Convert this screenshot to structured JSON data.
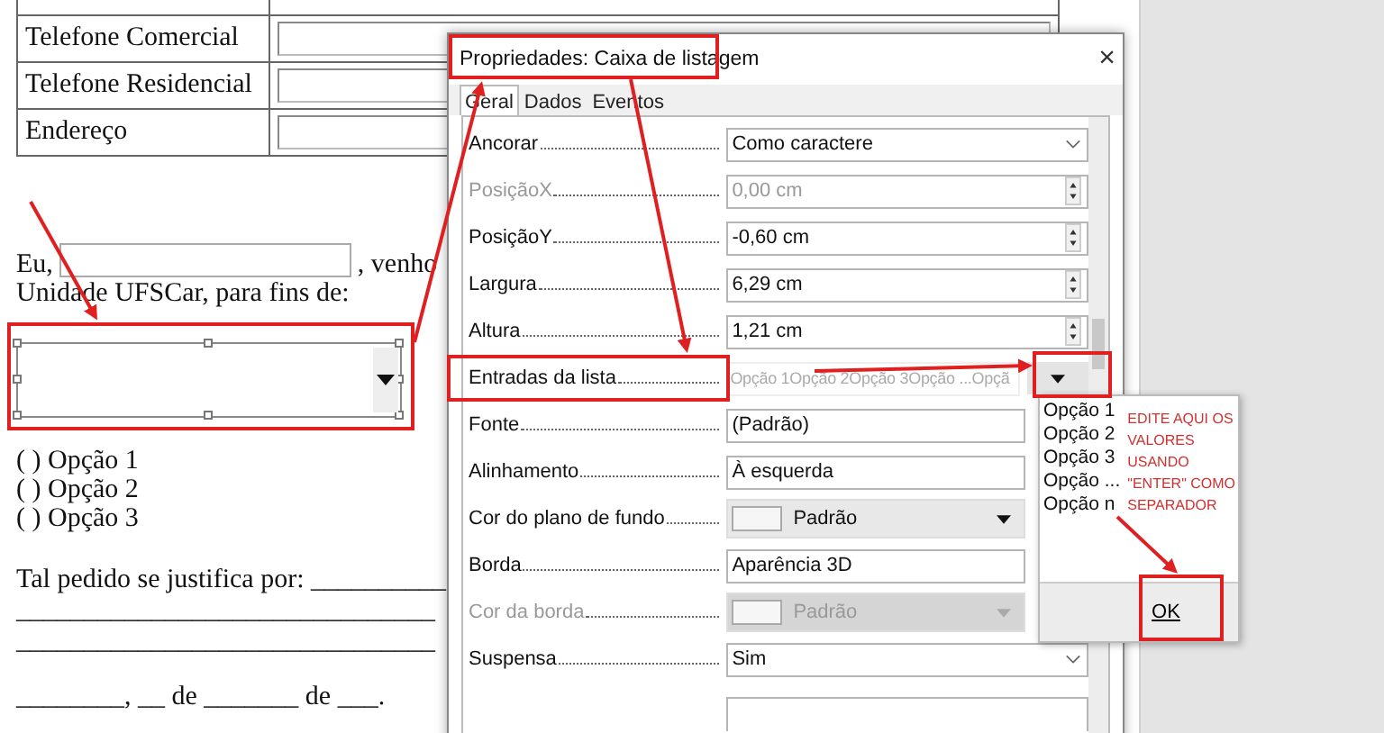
{
  "document": {
    "table_rows": [
      {
        "label": "Telefone Comercial"
      },
      {
        "label": "Telefone Residencial"
      },
      {
        "label": "Endereço"
      }
    ],
    "intro": {
      "before": "Eu,",
      "after": ", venho",
      "second_line": "Unidade UFSCar, para fins de:"
    },
    "options": [
      "( ) Opção 1",
      "( ) Opção 2",
      "( ) Opção 3"
    ],
    "justification": "Tal pedido se justifica por: __________",
    "blank_lines": [
      "_______________________________",
      "_______________________________"
    ],
    "date_line": "________, __ de _______ de ___."
  },
  "dialog": {
    "title": "Propriedades: Caixa de listagem",
    "close": "×",
    "tabs": [
      {
        "label": "Geral",
        "selected": true
      },
      {
        "label": "Dados",
        "selected": false
      },
      {
        "label": "Eventos",
        "selected": false
      }
    ],
    "properties": [
      {
        "label": "Ancorar",
        "kind": "dropdown",
        "value": "Como caractere",
        "disabled": false
      },
      {
        "label": "PosiçãoX",
        "kind": "spin",
        "value": "0,00 cm",
        "disabled": true
      },
      {
        "label": "PosiçãoY",
        "kind": "spin",
        "value": "-0,60 cm",
        "disabled": false
      },
      {
        "label": "Largura",
        "kind": "spin",
        "value": "6,29 cm",
        "disabled": false
      },
      {
        "label": "Altura",
        "kind": "spin",
        "value": "1,21 cm",
        "disabled": false
      },
      {
        "label": "Entradas da lista",
        "kind": "entries",
        "value": "Opção 1Opção 2Opção 3Opção ...Opçã",
        "disabled": false
      },
      {
        "label": "Fonte",
        "kind": "text",
        "value": "(Padrão)",
        "disabled": false
      },
      {
        "label": "Alinhamento",
        "kind": "text",
        "value": "À esquerda",
        "disabled": false
      },
      {
        "label": "Cor do plano de fundo",
        "kind": "color",
        "value": "Padrão",
        "disabled": false
      },
      {
        "label": "Borda",
        "kind": "text",
        "value": "Aparência 3D",
        "disabled": false
      },
      {
        "label": "Cor da borda",
        "kind": "color",
        "value": "Padrão",
        "disabled": true
      },
      {
        "label": "Suspensa",
        "kind": "dropdown",
        "value": "Sim",
        "disabled": false
      }
    ]
  },
  "entries_popup": {
    "items": [
      "Opção 1",
      "Opção 2",
      "Opção 3",
      "Opção ...",
      "Opção n"
    ],
    "ok": "OK"
  },
  "annotation": {
    "text": "EDITE AQUI OS VALORES USANDO \"ENTER\" COMO SEPARADOR"
  }
}
